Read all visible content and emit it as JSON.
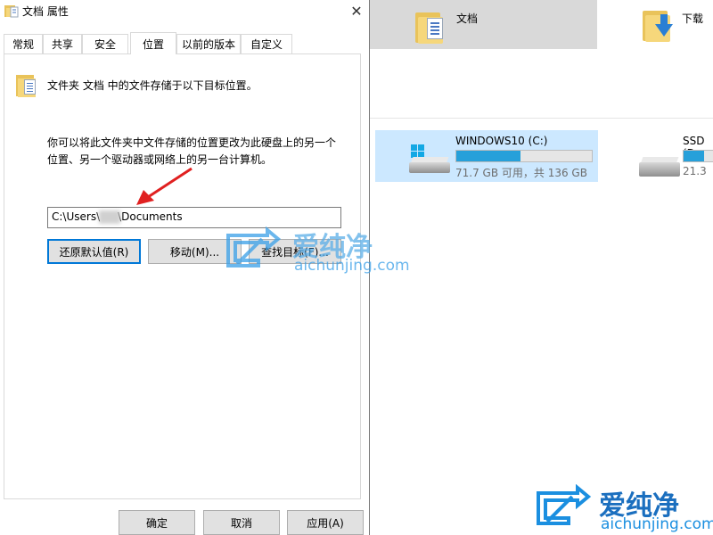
{
  "dialog": {
    "title": "文档 属性",
    "close_glyph": "✕",
    "tabs": [
      {
        "label": "常规"
      },
      {
        "label": "共享"
      },
      {
        "label": "安全"
      },
      {
        "label": "位置"
      },
      {
        "label": "以前的版本"
      },
      {
        "label": "自定义"
      }
    ],
    "active_tab": "位置",
    "heading": "文件夹 文档 中的文件存储于以下目标位置。",
    "description_line1": "你可以将此文件夹中文件存储的位置更改为此硬盘上的另一个",
    "description_line2": "位置、另一个驱动器或网络上的另一台计算机。",
    "path_prefix": "C:\\Users\\",
    "path_suffix": "\\Documents",
    "buttons": {
      "restore_default": "还原默认值(R)",
      "move": "移动(M)...",
      "find_target": "查找目标(F)..."
    },
    "footer": {
      "ok": "确定",
      "cancel": "取消",
      "apply": "应用(A)"
    }
  },
  "explorer": {
    "folders": [
      {
        "label": "文档",
        "icon": "documents-folder-icon"
      },
      {
        "label": "下载",
        "icon": "downloads-folder-icon"
      }
    ],
    "drives": [
      {
        "name": "WINDOWS10 (C:)",
        "info": "71.7 GB 可用，共 136 GB",
        "used_fraction": 0.473
      },
      {
        "name": "SSD (D",
        "info": "21.3",
        "used_fraction": 0.6
      }
    ]
  },
  "watermark": {
    "brand": "爱纯净",
    "url": "aichunjing.com"
  },
  "colors": {
    "accent": "#0078d7",
    "drive_selected": "#cce8ff",
    "drive_bar": "#26a0da",
    "annotation_arrow": "#e02020",
    "watermark": "#1b8fe0"
  }
}
